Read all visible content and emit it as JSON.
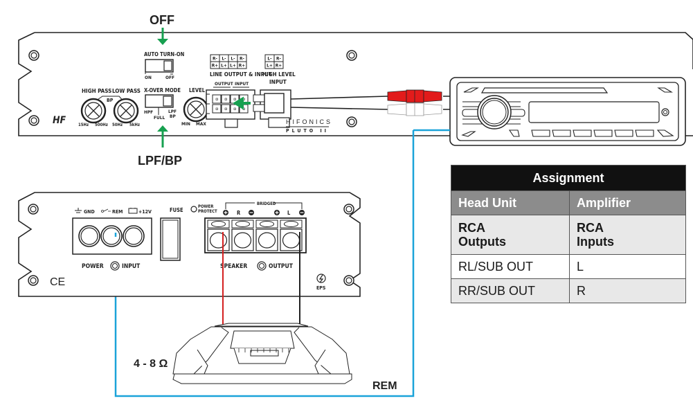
{
  "callouts": {
    "off": "OFF",
    "lpf_bp": "LPF/BP",
    "impedance": "4 - 8 Ω",
    "rem": "REM"
  },
  "top_amp": {
    "auto_turn_on": {
      "label": "AUTO TURN-ON",
      "left": "ON",
      "right": "OFF"
    },
    "xover_mode": {
      "label": "X-OVER MODE",
      "left": "HPF",
      "middle": "FULL",
      "right_1": "LPF",
      "right_2": "BP"
    },
    "high_pass": {
      "label": "HIGH PASS",
      "min": "15Hz",
      "max": "500Hz"
    },
    "low_pass": {
      "label": "LOW PASS",
      "min": "50Hz",
      "max": "5kHz"
    },
    "bp_label": "BP",
    "level": {
      "label": "LEVEL",
      "min": "MIN",
      "max": "MAX"
    },
    "line_io": {
      "grid": [
        [
          "R-",
          "L-",
          "L-",
          "R-"
        ],
        [
          "R+",
          "L+",
          "L+",
          "R+"
        ]
      ],
      "label": "LINE OUTPUT & INPUT",
      "output": "OUTPUT",
      "input": "INPUT"
    },
    "high_level": {
      "grid": [
        [
          "L-",
          "R-"
        ],
        [
          "L+",
          "R+"
        ]
      ],
      "label_1": "HIGH LEVEL",
      "label_2": "INPUT"
    },
    "brand": "HIFONICS",
    "model": "PLUTO II",
    "logo": "HF"
  },
  "bottom_amp": {
    "gnd": "GND",
    "rem": "REM",
    "plus12v": "+12V",
    "fuse": "FUSE",
    "power_protect_1": "POWER",
    "power_protect_2": "PROTECT",
    "bridged": "BRIDGED",
    "right": "R",
    "left": "L",
    "power_input_1": "POWER",
    "power_input_2": "INPUT",
    "speaker_output_1": "SPEAKER",
    "speaker_output_2": "OUTPUT",
    "ce": "CE",
    "eps": "EPS"
  },
  "colors": {
    "arrow_green": "#17a050",
    "rem_wire_blue": "#1aa3d9",
    "speaker_wire_red": "#d42020",
    "rca_red": "#e21b1b",
    "rca_white": "#ffffff"
  },
  "table": {
    "title": "Assignment",
    "headers": [
      "Head Unit",
      "Amplifier"
    ],
    "subheader": [
      [
        "RCA",
        "Outputs"
      ],
      [
        "RCA",
        "Inputs"
      ]
    ],
    "rows": [
      [
        "RL/SUB OUT",
        "L"
      ],
      [
        "RR/SUB OUT",
        "R"
      ]
    ]
  }
}
